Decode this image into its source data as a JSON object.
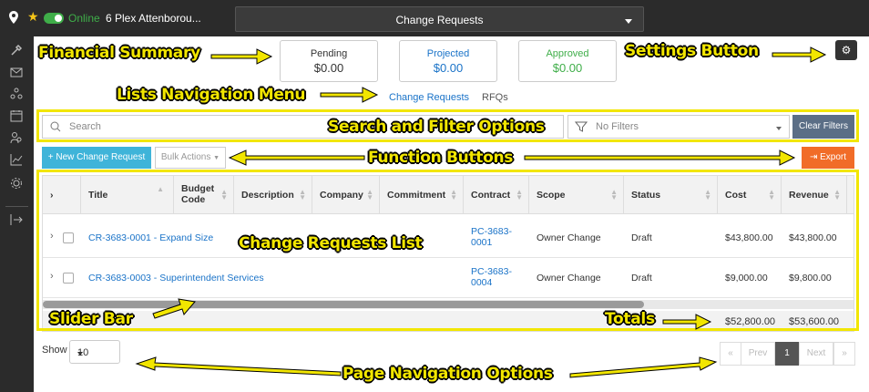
{
  "topbar": {
    "status": "Online",
    "project": "6 Plex Attenborou...",
    "module_title": "Change Requests"
  },
  "summary": {
    "pending": {
      "label": "Pending",
      "value": "$0.00"
    },
    "projected": {
      "label": "Projected",
      "value": "$0.00"
    },
    "approved": {
      "label": "Approved",
      "value": "$0.00"
    }
  },
  "tabs": [
    "Change Requests",
    "RFQs"
  ],
  "search": {
    "placeholder": "Search",
    "filter_placeholder": "No Filters",
    "clear_label": "Clear Filters"
  },
  "actions": {
    "new_label": "+ New Change Request",
    "bulk_label": "Bulk Actions",
    "export_label": "Export"
  },
  "table": {
    "headers": [
      "Title",
      "Budget Code",
      "Description",
      "Company",
      "Commitment",
      "Contract",
      "Scope",
      "Status",
      "Cost",
      "Revenue"
    ],
    "rows": [
      {
        "title": "CR-3683-0001 - Expand Size",
        "contract": "PC-3683-0001",
        "scope": "Owner Change",
        "status": "Draft",
        "cost": "$43,800.00",
        "revenue": "$43,800.00"
      },
      {
        "title": "CR-3683-0003 - Superintendent Services",
        "contract": "PC-3683-0004",
        "scope": "Owner Change",
        "status": "Draft",
        "cost": "$9,000.00",
        "revenue": "$9,800.00"
      }
    ],
    "totals": {
      "cost": "$52,800.00",
      "revenue": "$53,600.00"
    }
  },
  "pagination": {
    "show_label": "Show",
    "per_page": "10",
    "first": "«",
    "prev": "Prev",
    "current": "1",
    "next": "Next",
    "last": "»"
  },
  "annotations": {
    "financial_summary": "Financial Summary",
    "settings_button": "Settings Button",
    "lists_nav": "Lists Navigation Menu",
    "search_filter": "Search and Filter Options",
    "function_buttons": "Function Buttons",
    "change_requests_list": "Change Requests List",
    "slider_bar": "Slider Bar",
    "totals": "Totals",
    "page_nav": "Page Navigation Options"
  },
  "colors": {
    "accent": "#1a73c8",
    "online": "#3fae49",
    "new_button": "#3fb4d9",
    "export_button": "#f16c28",
    "annotation": "#f2e600",
    "projected": "#1a73c8",
    "approved": "#3fae49"
  }
}
